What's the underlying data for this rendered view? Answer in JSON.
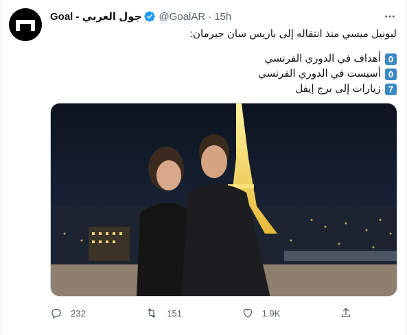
{
  "account": {
    "display_name": "Goal - جول العربي",
    "handle": "@GoalAR",
    "separator": "·",
    "timestamp": "15h",
    "verified": true
  },
  "tweet": {
    "intro": "ليونيل ميسي منذ انتقاله إلى باريس سان جيرمان:",
    "items": [
      {
        "count": "0",
        "label": "أهداف في الدوري الفرنسي"
      },
      {
        "count": "0",
        "label": "أسيست في الدوري الفرنسي"
      },
      {
        "count": "7",
        "label": "زيارات إلى برج إيفل"
      }
    ]
  },
  "media": {
    "description_icon": "photo-eiffel-tower-couple"
  },
  "actions": {
    "reply_count": "232",
    "retweet_count": "151",
    "like_count": "1.9K"
  },
  "colors": {
    "accent": "#1d9bf0",
    "badge": "#3b88c3",
    "muted": "#536471"
  }
}
